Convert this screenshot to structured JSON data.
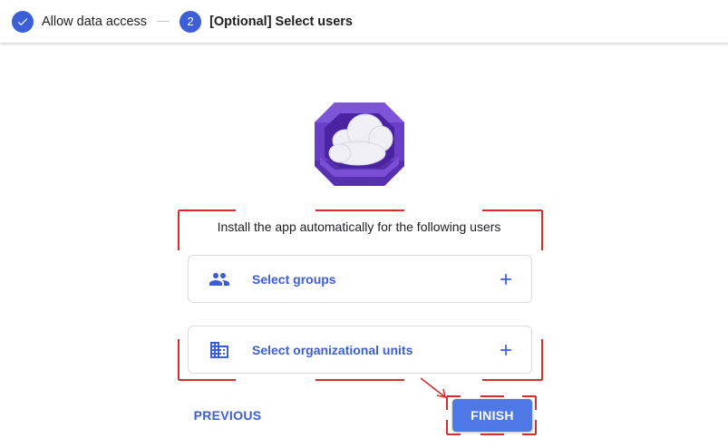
{
  "stepper": {
    "steps": [
      {
        "label": "Allow data access",
        "state": "completed",
        "icon": "check-icon"
      },
      {
        "number": "2",
        "label": "[Optional] Select users",
        "state": "active"
      }
    ]
  },
  "main": {
    "logo": "cloud-box-app-logo",
    "instruction": "Install the app automatically for the following users",
    "options": [
      {
        "label": "Select groups",
        "icon": "group-icon",
        "action_icon": "add-icon"
      },
      {
        "label": "Select organizational units",
        "icon": "building-icon",
        "action_icon": "add-icon"
      }
    ]
  },
  "footer": {
    "previous_label": "PREVIOUS",
    "finish_label": "FINISH"
  },
  "colors": {
    "accent": "#3c5ed6",
    "finish_button": "#4d78e6",
    "annotation": "#d32f2f",
    "logo_purple": "#6a3fc8"
  }
}
